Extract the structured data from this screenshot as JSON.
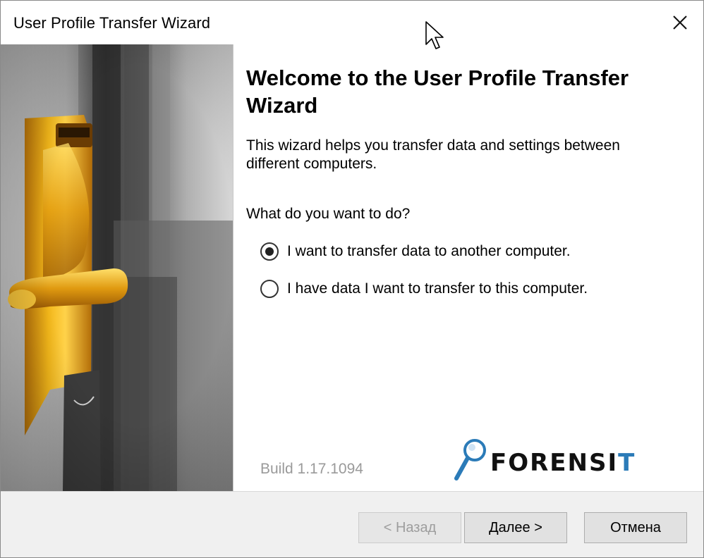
{
  "window": {
    "title": "User Profile Transfer Wizard"
  },
  "content": {
    "heading": "Welcome to the User Profile Transfer Wizard",
    "description": "This wizard helps you transfer data and settings between different computers.",
    "question": "What do you want to do?",
    "options": [
      {
        "label": "I want to transfer data to another computer.",
        "checked": true
      },
      {
        "label": "I have data I want to transfer to this computer.",
        "checked": false
      }
    ],
    "build": "Build 1.17.1094",
    "logo": {
      "text_main": "FORENSI",
      "text_accent": "T"
    }
  },
  "footer": {
    "back_label": "< Назад",
    "next_label": "Далее >",
    "cancel_label": "Отмена"
  },
  "colors": {
    "accent": "#2b7bb8",
    "gold": "#e6a20a",
    "disabled_text": "#9d9d9d"
  }
}
